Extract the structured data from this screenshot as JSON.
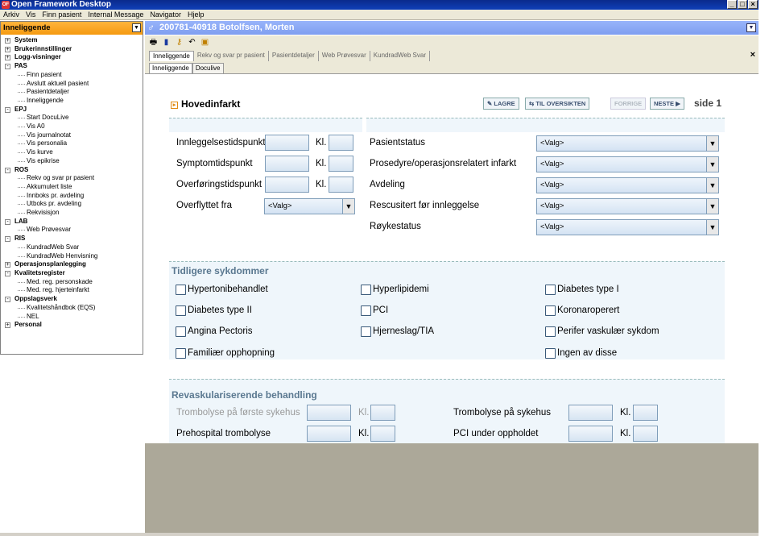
{
  "window": {
    "title": "Open Framework Desktop",
    "app_icon": "OF"
  },
  "menu": [
    "Arkiv",
    "Vis",
    "Finn pasient",
    "Internal Message",
    "Navigator",
    "Hjelp"
  ],
  "sidebar": {
    "header": "Inneliggende",
    "tree": [
      {
        "label": "System",
        "level": 0,
        "expander": "+"
      },
      {
        "label": "Brukerinnstillinger",
        "level": 0,
        "expander": "+"
      },
      {
        "label": "Logg-visninger",
        "level": 0,
        "expander": "+"
      },
      {
        "label": "PAS",
        "level": 0,
        "expander": "-"
      },
      {
        "label": "Finn pasient",
        "level": 1
      },
      {
        "label": "Avslutt aktuell pasient",
        "level": 1
      },
      {
        "label": "Pasientdetaljer",
        "level": 1
      },
      {
        "label": "Inneliggende",
        "level": 1
      },
      {
        "label": "EPJ",
        "level": 0,
        "expander": "-"
      },
      {
        "label": "Start DocuLive",
        "level": 1
      },
      {
        "label": "Vis A0",
        "level": 1
      },
      {
        "label": "Vis journalnotat",
        "level": 1
      },
      {
        "label": "Vis personalia",
        "level": 1
      },
      {
        "label": "Vis kurve",
        "level": 1
      },
      {
        "label": "Vis epikrise",
        "level": 1
      },
      {
        "label": "ROS",
        "level": 0,
        "expander": "-"
      },
      {
        "label": "Rekv og svar pr pasient",
        "level": 1
      },
      {
        "label": "Akkumulert liste",
        "level": 1
      },
      {
        "label": "Innboks pr. avdeling",
        "level": 1
      },
      {
        "label": "Utboks pr. avdeling",
        "level": 1
      },
      {
        "label": "Rekvisisjon",
        "level": 1
      },
      {
        "label": "LAB",
        "level": 0,
        "expander": "-"
      },
      {
        "label": "Web Prøvesvar",
        "level": 1
      },
      {
        "label": "RIS",
        "level": 0,
        "expander": "-"
      },
      {
        "label": "KundradWeb Svar",
        "level": 1
      },
      {
        "label": "KundradWeb Henvisning",
        "level": 1
      },
      {
        "label": "Operasjonsplanlegging",
        "level": 0,
        "expander": "+"
      },
      {
        "label": "Kvalitetsregister",
        "level": 0,
        "expander": "-"
      },
      {
        "label": "Med. reg. personskade",
        "level": 1
      },
      {
        "label": "Med. reg. hjerteinfarkt",
        "level": 1
      },
      {
        "label": "Oppslagsverk",
        "level": 0,
        "expander": "-"
      },
      {
        "label": "Kvalitetshåndbok (EQS)",
        "level": 1
      },
      {
        "label": "NEL",
        "level": 1
      },
      {
        "label": "Personal",
        "level": 0,
        "expander": "+"
      }
    ]
  },
  "patient": {
    "header": "200781-40918  Botolfsen, Morten",
    "gender_symbol": "♂"
  },
  "toolbar_icons": [
    "print-icon",
    "book-icon",
    "key-icon",
    "undo-icon",
    "save-icon"
  ],
  "tabs_row1": [
    "Inneliggende",
    "Rekv og svar pr pasient",
    "Pasientdetaljer",
    "Web Prøvesvar",
    "KundradWeb Svar"
  ],
  "tabs_row2": [
    "Inneliggende",
    "Doculive"
  ],
  "form": {
    "title": "Hovedinfarkt",
    "buttons": {
      "save": "LAGRE",
      "overview": "TIL OVERSIKTEN",
      "prev": "FORRIGE",
      "next": "NESTE"
    },
    "page": "side 1",
    "kl": "Kl.",
    "select_placeholder": "<Valg>",
    "time_fields": [
      "Innleggelsestidspunkt",
      "Symptomtidspunkt",
      "Overføringstidspunkt"
    ],
    "transferred_from": "Overflyttet fra",
    "status_fields": [
      "Pasientstatus",
      "Prosedyre/operasjonsrelatert infarkt",
      "Avdeling",
      "Rescusitert før innleggelse",
      "Røykestatus"
    ],
    "previous_diseases": {
      "title": "Tidligere sykdommer",
      "items": [
        "Hypertonibehandlet",
        "Hyperlipidemi",
        "Diabetes type I",
        "Diabetes type II",
        "PCI",
        "Koronaroperert",
        "Angina Pectoris",
        "Hjerneslag/TIA",
        "Perifer vaskulær sykdom",
        "Familiær opphopning",
        "Ingen av disse"
      ]
    },
    "revascularization": {
      "title": "Revaskulariserende behandling",
      "fields": [
        "Trombolyse på første sykehus",
        "Trombolyse på sykehus",
        "Prehospital trombolyse",
        "PCI under oppholdet"
      ]
    }
  }
}
